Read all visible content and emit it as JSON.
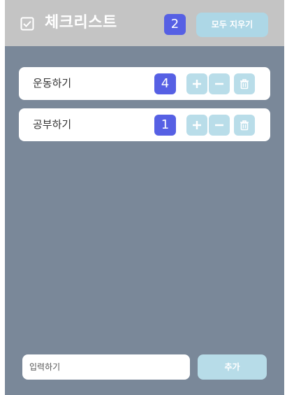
{
  "header": {
    "icon": "checkbox-checked-icon",
    "title": "체크리스트",
    "count": "2",
    "clear_label": "모두 지우기"
  },
  "items": [
    {
      "label": "운동하기",
      "count": "4"
    },
    {
      "label": "공부하기",
      "count": "1"
    }
  ],
  "icons": {
    "plus": "plus-icon",
    "minus": "minus-icon",
    "trash": "trash-icon"
  },
  "input": {
    "placeholder": "입력하기"
  },
  "add_label": "추가",
  "colors": {
    "app_bg": "#7a8899",
    "header_bg": "#c4c4c4",
    "badge": "#5660e4",
    "button": "#add7e6"
  }
}
